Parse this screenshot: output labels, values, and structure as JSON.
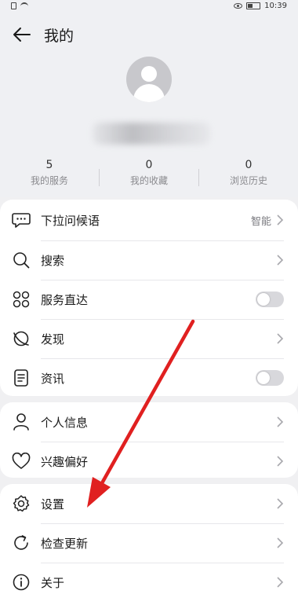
{
  "status_bar": {
    "time": "10:39"
  },
  "header": {
    "title": "我的"
  },
  "stats": [
    {
      "value": "5",
      "label": "我的服务"
    },
    {
      "value": "0",
      "label": "我的收藏"
    },
    {
      "value": "0",
      "label": "浏览历史"
    }
  ],
  "menu1": {
    "items": [
      {
        "label": "下拉问候语",
        "value": "智能",
        "icon": "chat-bubble-icon",
        "control": "chevron"
      },
      {
        "label": "搜索",
        "icon": "search-icon",
        "control": "chevron"
      },
      {
        "label": "服务直达",
        "icon": "grid-icon",
        "control": "toggle",
        "toggle_on": false
      },
      {
        "label": "发现",
        "icon": "planet-icon",
        "control": "chevron"
      },
      {
        "label": "资讯",
        "icon": "document-icon",
        "control": "toggle",
        "toggle_on": false
      }
    ]
  },
  "menu2": {
    "items": [
      {
        "label": "个人信息",
        "icon": "person-icon"
      },
      {
        "label": "兴趣偏好",
        "icon": "heart-icon"
      }
    ]
  },
  "menu3": {
    "items": [
      {
        "label": "设置",
        "icon": "gear-icon"
      },
      {
        "label": "检查更新",
        "icon": "refresh-icon"
      },
      {
        "label": "关于",
        "icon": "info-icon"
      }
    ]
  },
  "annotation": {
    "arrow_color": "#e02020"
  }
}
